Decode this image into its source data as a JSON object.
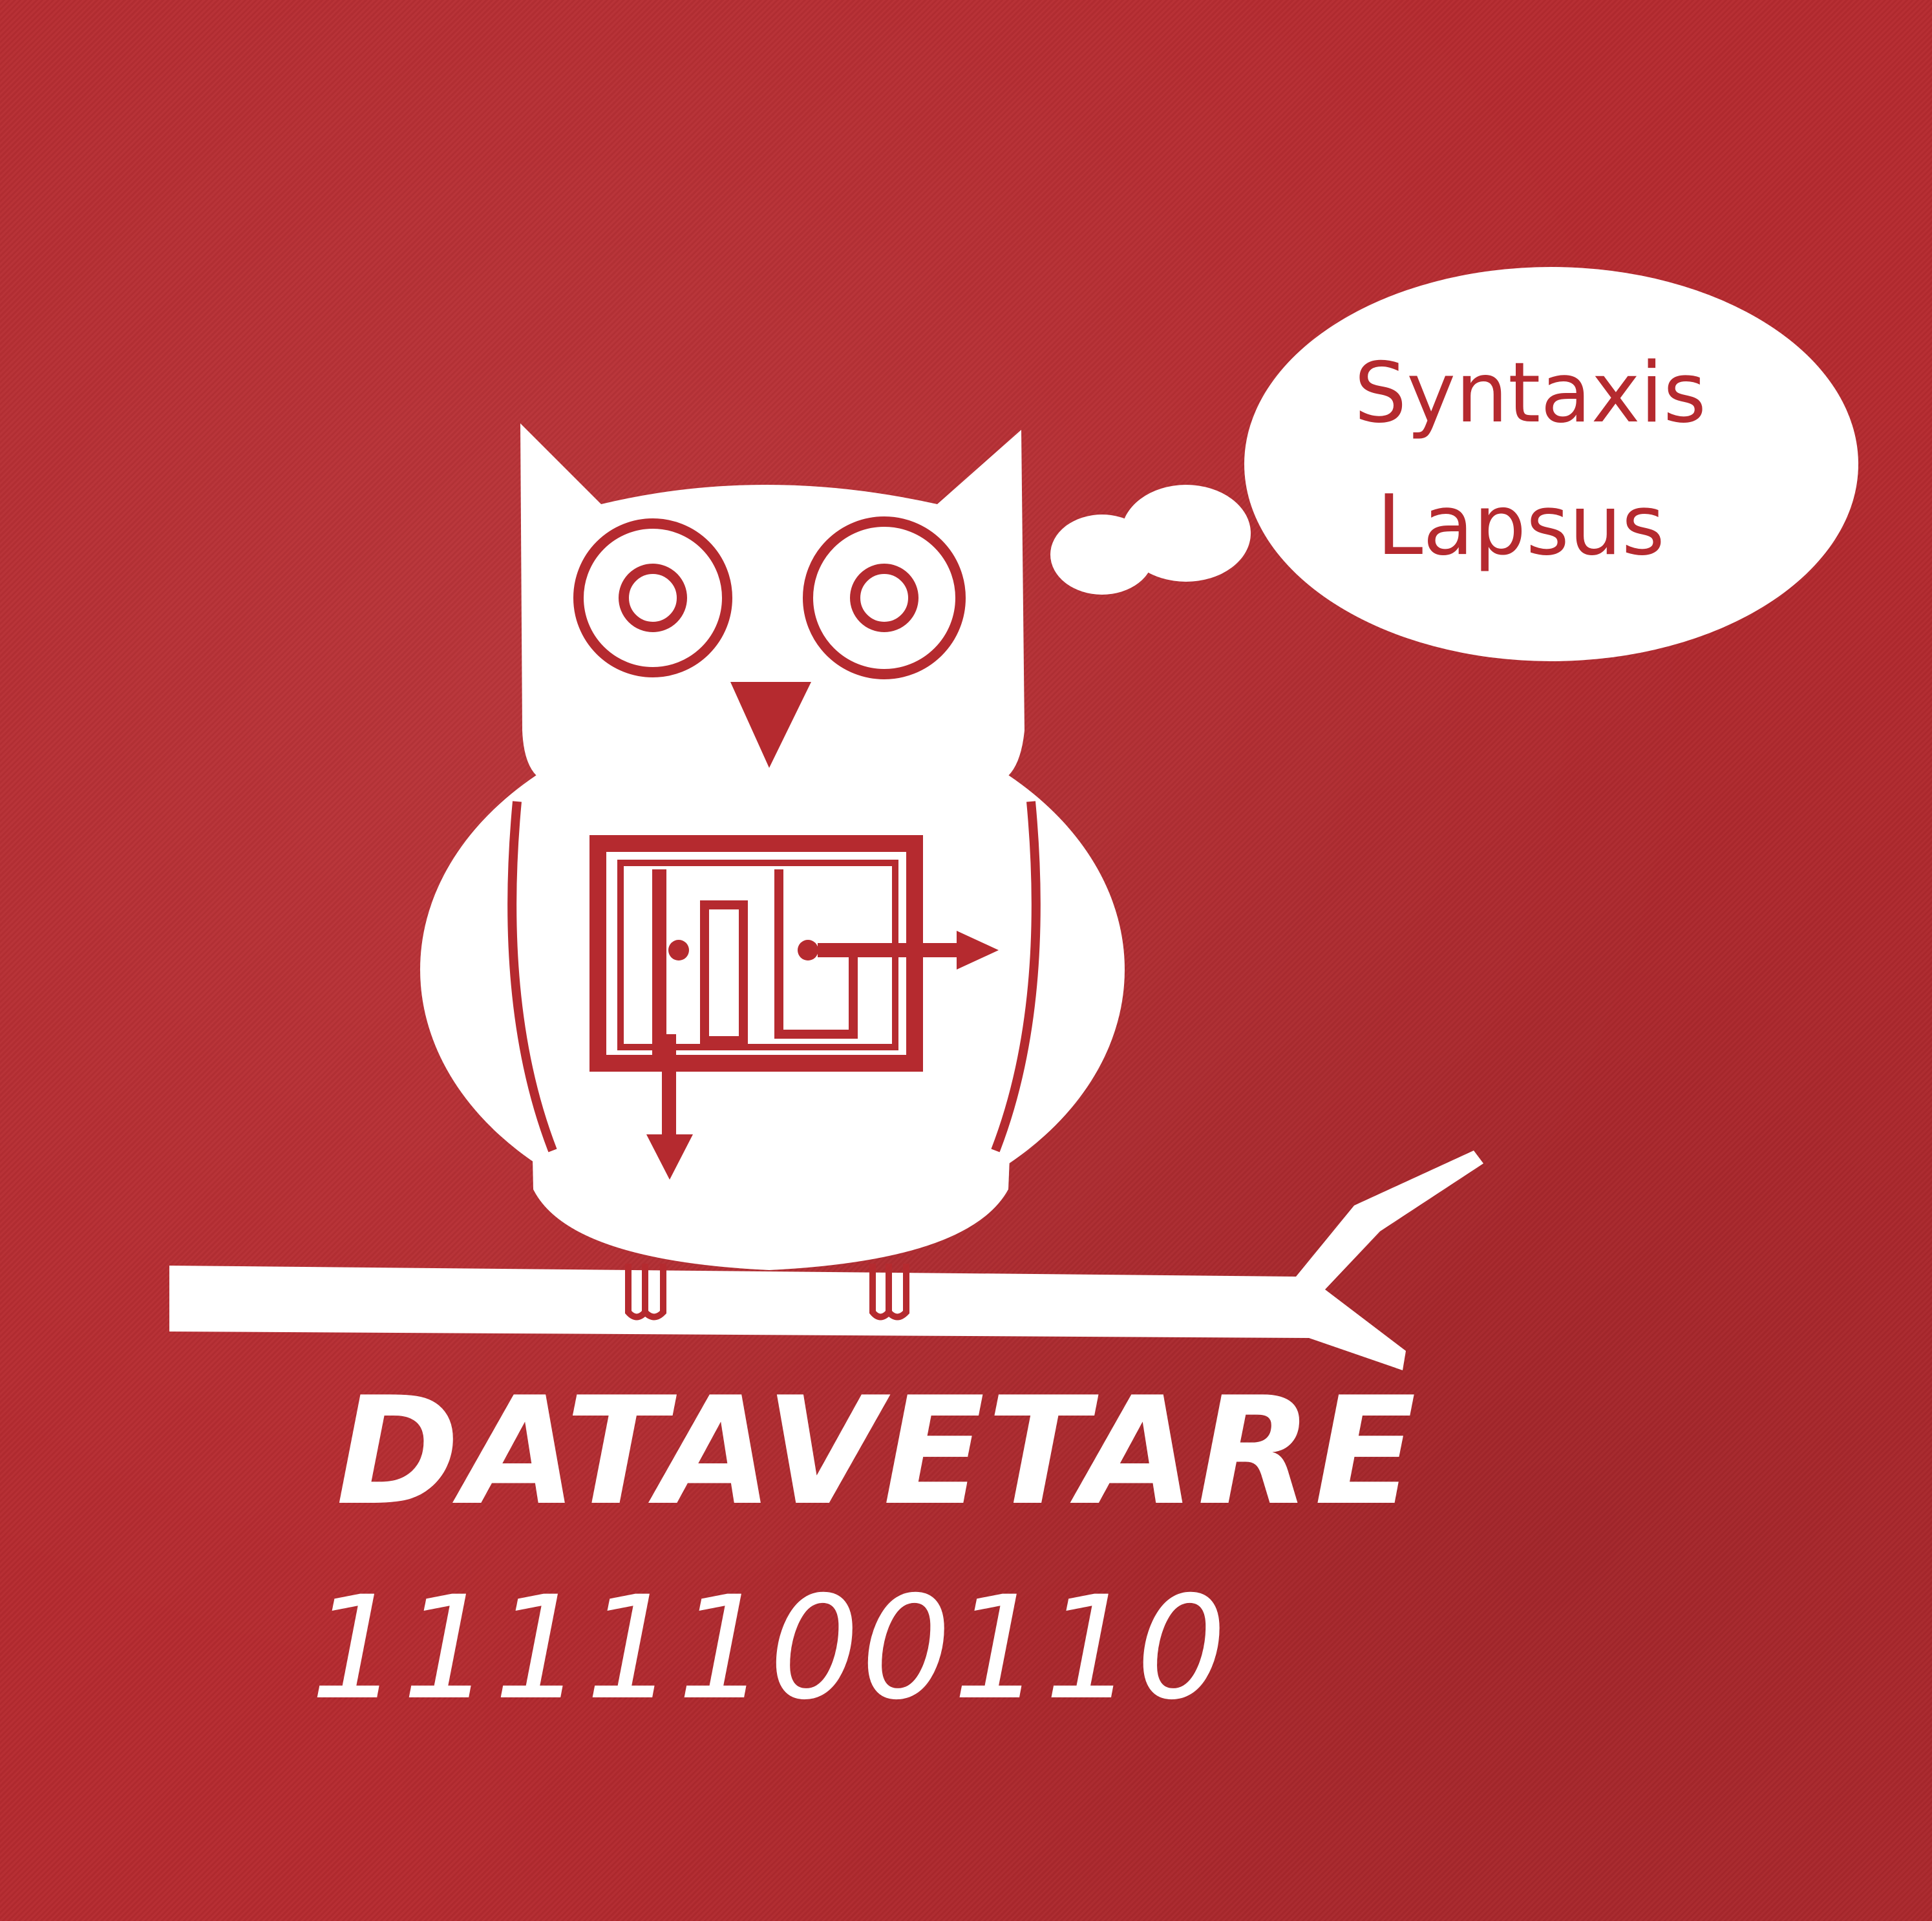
{
  "colors": {
    "fabric": "#b52a2f",
    "print": "#ffffff"
  },
  "thought_bubble": {
    "line1": "Syntaxis",
    "line2": "Lapsus"
  },
  "title": "DATAVETARE",
  "binary": "1111100110",
  "icons": [
    "owl-icon",
    "flowchart-icon",
    "branch-icon",
    "thought-bubble-icon"
  ]
}
